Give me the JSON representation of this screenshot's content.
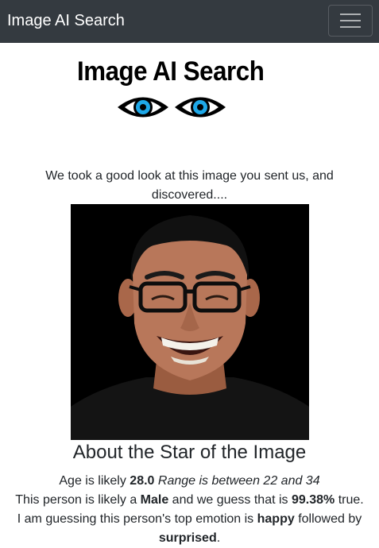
{
  "navbar": {
    "brand": "Image AI Search",
    "toggler_icon": "hamburger-menu-icon"
  },
  "logo": {
    "text": "Image AI Search",
    "icon": "eyes-icon"
  },
  "intro": "We took a good look at this image you sent us, and discovered....",
  "photo": {
    "icon": "person-photo"
  },
  "result": {
    "heading": "About the Star of the Image",
    "age_prefix": "Age is likely ",
    "age_value": "28.0",
    "age_range": "Range is between 22 and 34",
    "gender_prefix": "This person is likely a ",
    "gender_value": "Male",
    "gender_mid": " and we guess that is ",
    "gender_confidence": "99.38%",
    "gender_suffix": " true.",
    "emotion_prefix": "I am guessing this person's top emotion is ",
    "emotion_top": "happy",
    "emotion_mid": " followed by",
    "emotion_second": "surprised",
    "emotion_suffix": "."
  },
  "colors": {
    "navbar_bg": "#343a40",
    "eye_iris": "#1ea8e8",
    "text": "#212529"
  }
}
